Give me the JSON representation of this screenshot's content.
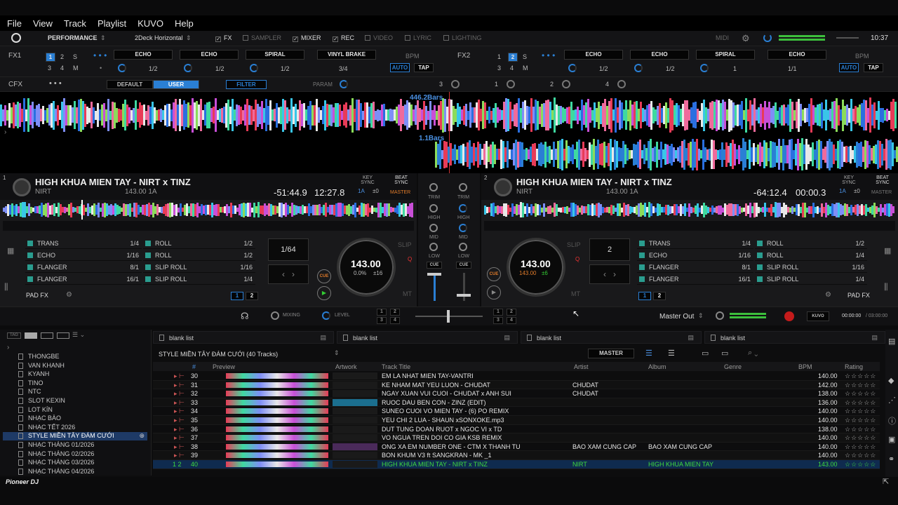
{
  "menu": [
    "File",
    "View",
    "Track",
    "Playlist",
    "KUVO",
    "Help"
  ],
  "toolbar": {
    "mode": "PERFORMANCE",
    "layout": "2Deck Horizontal",
    "fx": "FX",
    "sampler": "SAMPLER",
    "mixer": "MIXER",
    "rec": "REC",
    "video": "VIDEO",
    "lyric": "LYRIC",
    "lighting": "LIGHTING",
    "midi": "MIDI",
    "clock": "10:37"
  },
  "fx1": {
    "label": "FX1",
    "banks": [
      "1",
      "2",
      "S",
      "3",
      "4",
      "M"
    ],
    "slots": [
      {
        "name": "ECHO",
        "beat": "1/2"
      },
      {
        "name": "ECHO",
        "beat": "1/2"
      },
      {
        "name": "SPIRAL",
        "beat": "1/2"
      }
    ],
    "brake": "VINYL BRAKE",
    "brake_beat": "3/4",
    "bpm": "BPM",
    "auto": "AUTO",
    "tap": "TAP"
  },
  "fx2": {
    "label": "FX2",
    "banks": [
      "1",
      "2",
      "S",
      "3",
      "4",
      "M"
    ],
    "slots": [
      {
        "name": "ECHO",
        "beat": "1/2"
      },
      {
        "name": "ECHO",
        "beat": "1/2"
      },
      {
        "name": "SPIRAL",
        "beat": "1"
      }
    ],
    "brake": "ECHO",
    "brake_beat": "1/1",
    "bpm": "BPM",
    "auto": "AUTO",
    "tap": "TAP"
  },
  "cfx": {
    "label": "CFX",
    "default": "DEFAULT",
    "user": "USER",
    "filter": "FILTER",
    "param": "PARAM",
    "nums": [
      "3",
      "1",
      "2",
      "4"
    ]
  },
  "wave": {
    "bars1": "446.2Bars",
    "bars2": "1.1Bars"
  },
  "deck1": {
    "num": "1",
    "title": "HIGH KHUA MIEN TAY - NIRT x TINZ",
    "artist": "NIRT",
    "bpmkey": "143.00  1A",
    "remain": "-51:44.9",
    "elapsed": "12:27.8",
    "keysync": "KEY SYNC",
    "key": "1A",
    "keyoff": "±0",
    "beatsync": "BEAT SYNC",
    "master": "MASTER",
    "loop": "1/64",
    "jogbpm": "143.00",
    "jogpitch": "0.0%",
    "jogrange": "±16",
    "cue": "CUE",
    "slip": "SLIP",
    "mt": "MT",
    "padfx": "PAD FX",
    "pages": [
      "1",
      "2"
    ],
    "pads": [
      [
        "TRANS",
        "1/4"
      ],
      [
        "ECHO",
        "1/16"
      ],
      [
        "FLANGER",
        "8/1"
      ],
      [
        "FLANGER",
        "16/1"
      ]
    ],
    "pads2": [
      [
        "ROLL",
        "1/2"
      ],
      [
        "ROLL",
        "1/2"
      ],
      [
        "SLIP ROLL",
        "1/16"
      ],
      [
        "SLIP ROLL",
        "1/4"
      ]
    ]
  },
  "deck2": {
    "num": "2",
    "title": "HIGH KHUA MIEN TAY - NIRT x TINZ",
    "artist": "NIRT",
    "bpmkey": "143.00  1A",
    "remain": "-64:12.4",
    "elapsed": "00:00.3",
    "keysync": "KEY SYNC",
    "key": "1A",
    "keyoff": "±0",
    "beatsync": "BEAT SYNC",
    "master": "MASTER",
    "loop": "2",
    "jogbpm": "143.00",
    "jogpitch": "143.00",
    "jogrange": "±6",
    "cue": "CUE",
    "slip": "SLIP",
    "mt": "MT",
    "padfx": "PAD FX",
    "pages": [
      "1",
      "2"
    ],
    "pads": [
      [
        "TRANS",
        "1/4"
      ],
      [
        "ECHO",
        "1/16"
      ],
      [
        "FLANGER",
        "8/1"
      ],
      [
        "FLANGER",
        "16/1"
      ]
    ],
    "pads2": [
      [
        "ROLL",
        "1/2"
      ],
      [
        "ROLL",
        "1/4"
      ],
      [
        "SLIP ROLL",
        "1/16"
      ],
      [
        "SLIP ROLL",
        "1/4"
      ]
    ]
  },
  "mixer": {
    "trim": "TRIM",
    "high": "HIGH",
    "mid": "MID",
    "low": "LOW",
    "cue": "CUE"
  },
  "mixbar": {
    "mixing": "MIXING",
    "level": "LEVEL",
    "masterout": "Master Out",
    "kuvo": "KUVO",
    "time": "00:00:00",
    "total": "/ 03:00:00",
    "pads": [
      "1",
      "2",
      "3",
      "4"
    ]
  },
  "browser": {
    "tabs": [
      "blank list",
      "blank list",
      "blank list",
      "blank list"
    ],
    "playlist": "STYLE MIỀN TÂY ĐÁM CƯỚI (40 Tracks)",
    "master": "MASTER",
    "tree": [
      "THONGBE",
      "VAN KHANH",
      "KYANH",
      "TINO",
      "NTC",
      "SLOT KEXIN",
      "LOT KÍN",
      "NHẠC BÀO",
      "NHẠC TẾT 2026",
      "STYLE MIỀN TÂY ĐÁM CƯỚI",
      "NHẠC THÁNG 01/2026",
      "NHẠC THÁNG 02/2026",
      "NHẠC THÁNG 03/2026",
      "NHẠC THÁNG 04/2026"
    ],
    "headers": {
      "num": "#",
      "preview": "Preview",
      "artwork": "Artwork",
      "title": "Track Title",
      "artist": "Artist",
      "album": "Album",
      "genre": "Genre",
      "bpm": "BPM",
      "rating": "Rating"
    },
    "rows": [
      {
        "n": "30",
        "title": "EM LA NHAT MIEN TAY-VANTRI",
        "artist": "",
        "album": "",
        "bpm": "140.00"
      },
      {
        "n": "31",
        "title": "KE NHAM MAT YEU LUON - CHUDAT",
        "artist": "CHUDAT",
        "album": "",
        "bpm": "142.00"
      },
      {
        "n": "32",
        "title": "NGAY XUAN VUI CUOI - CHUDAT x ANH SUI",
        "artist": "CHUDAT",
        "album": "",
        "bpm": "138.00"
      },
      {
        "n": "33",
        "title": "RUOC DAU BEN CON - ZINZ (EDIT)",
        "artist": "",
        "album": "",
        "bpm": "136.00"
      },
      {
        "n": "34",
        "title": "SUNEO CUOI VO MIEN TAY - (6) PO REMIX",
        "artist": "",
        "album": "",
        "bpm": "140.00"
      },
      {
        "n": "35",
        "title": "YEU CHI 2 LUA - SHAUN xSONXOKE.mp3",
        "artist": "",
        "album": "",
        "bpm": "140.00"
      },
      {
        "n": "36",
        "title": "DUT TUNG DOAN RUOT x NGOC VI x TD",
        "artist": "",
        "album": "",
        "bpm": "138.00"
      },
      {
        "n": "37",
        "title": "VO NGUA TREN DOI CO GIA KSB REMIX",
        "artist": "",
        "album": "",
        "bpm": "140.00"
      },
      {
        "n": "38",
        "title": "ONG XA EM NUMBER ONE - CTM X THANH TU",
        "artist": "BAO XAM CUNG CAP",
        "album": "BAO XAM CUNG CAP",
        "bpm": "140.00"
      },
      {
        "n": "39",
        "title": "BON KHUM V3 ft SANGKRAN - MK _1",
        "artist": "",
        "album": "",
        "bpm": "140.00"
      },
      {
        "n": "40",
        "title": "HIGH KHUA MIEN TAY - NIRT x TINZ",
        "artist": "NIRT",
        "album": "HIGH KHUA MIEN TAY",
        "bpm": "143.00"
      }
    ],
    "active_marks": "1 2"
  },
  "footer": {
    "logo": "Pioneer DJ"
  }
}
